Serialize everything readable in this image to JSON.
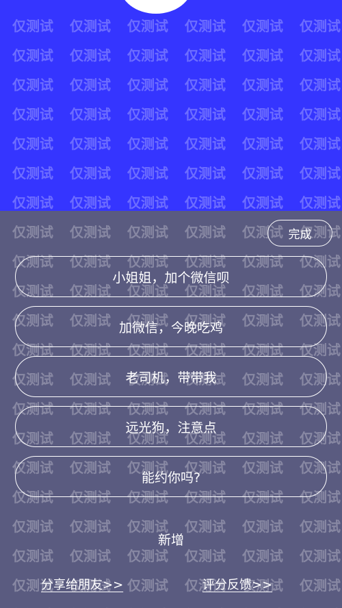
{
  "colors": {
    "top_background": "#3535ff",
    "bottom_background": "#5a5b80",
    "text": "#ffffff"
  },
  "watermark": {
    "text": "仅测试"
  },
  "toolbar": {
    "done_label": "完成"
  },
  "phrases": [
    {
      "label": "小姐姐，加个微信呗"
    },
    {
      "label": "加微信，今晚吃鸡"
    },
    {
      "label": "老司机，带带我"
    },
    {
      "label": "远光狗，注意点"
    },
    {
      "label": "能约你吗?"
    }
  ],
  "actions": {
    "add_label": "新增"
  },
  "footer": {
    "share_label": "分享给朋友>>",
    "feedback_label": "评分反馈>>"
  }
}
